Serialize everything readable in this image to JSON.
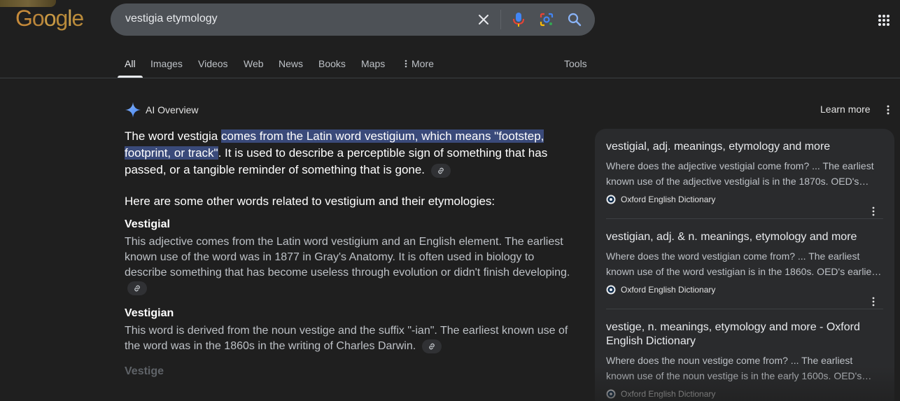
{
  "brand": {
    "logo_text": "Google"
  },
  "search": {
    "query": "vestigia etymology"
  },
  "icons": {
    "clear": "close-icon",
    "mic": "microphone-icon",
    "lens": "google-lens-icon",
    "search": "search-icon",
    "apps": "apps-grid-icon",
    "link": "link-icon",
    "more": "kebab-icon",
    "ai": "sparkle-icon"
  },
  "tabs": [
    {
      "label": "All",
      "active": true
    },
    {
      "label": "Images"
    },
    {
      "label": "Videos"
    },
    {
      "label": "Web"
    },
    {
      "label": "News"
    },
    {
      "label": "Books"
    },
    {
      "label": "Maps"
    },
    {
      "label": "More"
    }
  ],
  "tools_label": "Tools",
  "ai_overview": {
    "label": "AI Overview",
    "learn_more": "Learn more",
    "lead_prefix": "The word vestigia ",
    "lead_highlight": "comes from the Latin word vestigium, which means \"footstep, footprint, or track\"",
    "lead_suffix": ". It is used to describe a perceptible sign of something that has passed, or a tangible reminder of something that is gone.",
    "intro": "Here are some other words related to vestigium and their etymologies:",
    "entries": [
      {
        "term": "Vestigial",
        "desc": "This adjective comes from the Latin word vestigium and an English element. The earliest known use of the word was in 1877 in Gray's Anatomy. It is often used in biology to describe something that has become useless through evolution or didn't finish developing."
      },
      {
        "term": "Vestigian",
        "desc": "This word is derived from the noun vestige and the suffix \"-ian\". The earliest known use of the word was in the 1860s in the writing of Charles Darwin."
      },
      {
        "term": "Vestige",
        "desc": ""
      }
    ]
  },
  "sources": [
    {
      "title": "vestigial, adj. meanings, etymology and more",
      "snippet_1": "Where does the adjective vestigial come from? ... The earliest",
      "snippet_2": "known use of the adjective vestigial is in the 1870s. OED's…",
      "source": "Oxford English Dictionary"
    },
    {
      "title": "vestigian, adj. & n. meanings, etymology and more",
      "snippet_1": "Where does the word vestigian come from? ... The earliest",
      "snippet_2": "known use of the word vestigian is in the 1860s. OED's earlie…",
      "source": "Oxford English Dictionary"
    },
    {
      "title": "vestige, n. meanings, etymology and more - Oxford English Dictionary",
      "snippet_1": "Where does the noun vestige come from? ... The earliest",
      "snippet_2": "known use of the noun vestige is in the early 1600s. OED's…",
      "source": "Oxford English Dictionary"
    }
  ]
}
